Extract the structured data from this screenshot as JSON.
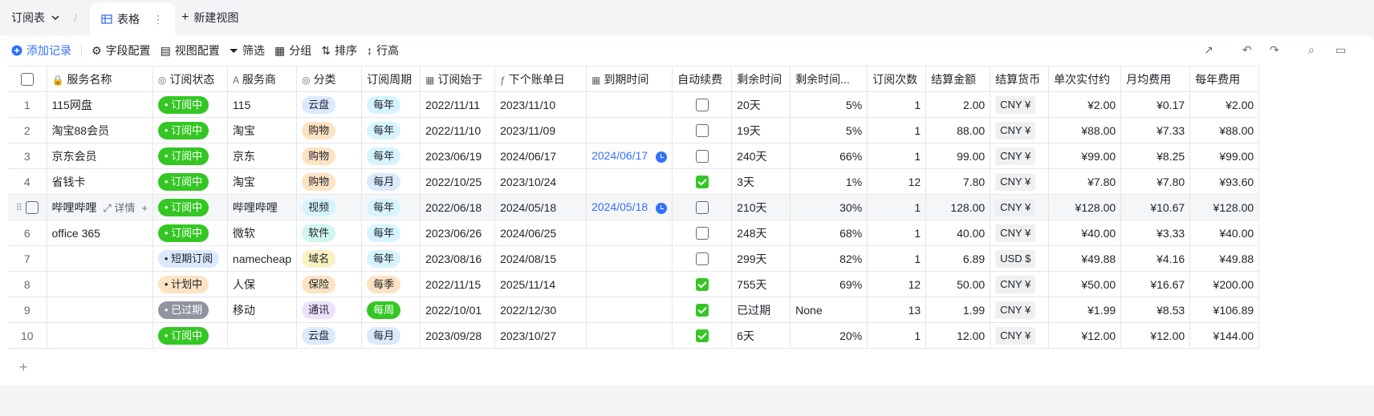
{
  "tabbar": {
    "table_name": "订阅表",
    "active_view": "表格",
    "new_view": "新建视图"
  },
  "toolbar": {
    "add_record": "添加记录",
    "field_config": "字段配置",
    "view_config": "视图配置",
    "filter": "筛选",
    "group": "分组",
    "sort": "排序",
    "row_height": "行高"
  },
  "columns": [
    "服务名称",
    "订阅状态",
    "服务商",
    "分类",
    "订阅周期",
    "订阅始于",
    "下个账单日",
    "到期时间",
    "自动续费",
    "剩余时间",
    "剩余时间...",
    "订阅次数",
    "结算金额",
    "结算货币",
    "单次实付约",
    "月均费用",
    "每年费用"
  ],
  "hover_row": {
    "detail_label": "详情"
  },
  "colors": {
    "accent": "#3370ff",
    "status_active": "#34c724",
    "status_expired": "#8f959e"
  },
  "rows": [
    {
      "idx": "1",
      "name": "115网盘",
      "status": "订阅中",
      "status_style": "active",
      "vendor": "115",
      "cat": "云盘",
      "cat_color": "#dbe9ff",
      "cycle": "每年",
      "cycle_color": "#d6f4ff",
      "start": "2022/11/11",
      "next": "2023/11/10",
      "expire": "",
      "auto": false,
      "remain": "20天",
      "remain_pct": "5%",
      "times": "1",
      "amount": "2.00",
      "currency": "CNY ¥",
      "once": "¥2.00",
      "monthly": "¥0.17",
      "yearly": "¥2.00"
    },
    {
      "idx": "2",
      "name": "淘宝88会员",
      "status": "订阅中",
      "status_style": "active",
      "vendor": "淘宝",
      "cat": "购物",
      "cat_color": "#fde3c4",
      "cycle": "每年",
      "cycle_color": "#d6f4ff",
      "start": "2022/11/10",
      "next": "2023/11/09",
      "expire": "",
      "auto": false,
      "remain": "19天",
      "remain_pct": "5%",
      "times": "1",
      "amount": "88.00",
      "currency": "CNY ¥",
      "once": "¥88.00",
      "monthly": "¥7.33",
      "yearly": "¥88.00"
    },
    {
      "idx": "3",
      "name": "京东会员",
      "status": "订阅中",
      "status_style": "active",
      "vendor": "京东",
      "cat": "购物",
      "cat_color": "#fde3c4",
      "cycle": "每年",
      "cycle_color": "#d6f4ff",
      "start": "2023/06/19",
      "next": "2024/06/17",
      "expire": "2024/06/17",
      "auto": false,
      "remain": "240天",
      "remain_pct": "66%",
      "times": "1",
      "amount": "99.00",
      "currency": "CNY ¥",
      "once": "¥99.00",
      "monthly": "¥8.25",
      "yearly": "¥99.00"
    },
    {
      "idx": "4",
      "name": "省钱卡",
      "status": "订阅中",
      "status_style": "active",
      "vendor": "淘宝",
      "cat": "购物",
      "cat_color": "#fde3c4",
      "cycle": "每月",
      "cycle_color": "#dbe9ff",
      "start": "2022/10/25",
      "next": "2023/10/24",
      "expire": "",
      "auto": true,
      "remain": "3天",
      "remain_pct": "1%",
      "times": "12",
      "amount": "7.80",
      "currency": "CNY ¥",
      "once": "¥7.80",
      "monthly": "¥7.80",
      "yearly": "¥93.60"
    },
    {
      "idx": "5",
      "name": "哔哩哔哩",
      "status": "订阅中",
      "status_style": "active",
      "vendor": "哔哩哔哩",
      "cat": "视频",
      "cat_color": "#d6f4ff",
      "cycle": "每年",
      "cycle_color": "#d6f4ff",
      "start": "2022/06/18",
      "next": "2024/05/18",
      "expire": "2024/05/18",
      "auto": false,
      "remain": "210天",
      "remain_pct": "30%",
      "times": "1",
      "amount": "128.00",
      "currency": "CNY ¥",
      "once": "¥128.00",
      "monthly": "¥10.67",
      "yearly": "¥128.00"
    },
    {
      "idx": "6",
      "name": "office 365",
      "status": "订阅中",
      "status_style": "active",
      "vendor": "微软",
      "cat": "软件",
      "cat_color": "#d1f5ef",
      "cycle": "每年",
      "cycle_color": "#d6f4ff",
      "start": "2023/06/26",
      "next": "2024/06/25",
      "expire": "",
      "auto": false,
      "remain": "248天",
      "remain_pct": "68%",
      "times": "1",
      "amount": "40.00",
      "currency": "CNY ¥",
      "once": "¥40.00",
      "monthly": "¥3.33",
      "yearly": "¥40.00"
    },
    {
      "idx": "7",
      "name": "",
      "status": "短期订阅",
      "status_style": "light-blue",
      "vendor": "namecheap",
      "cat": "域名",
      "cat_color": "#faf1c1",
      "cycle": "每年",
      "cycle_color": "#d6f4ff",
      "start": "2023/08/16",
      "next": "2024/08/15",
      "expire": "",
      "auto": false,
      "remain": "299天",
      "remain_pct": "82%",
      "times": "1",
      "amount": "6.89",
      "currency": "USD $",
      "once": "¥49.88",
      "monthly": "¥4.16",
      "yearly": "¥49.88"
    },
    {
      "idx": "8",
      "name": "",
      "status": "计划中",
      "status_style": "light-orange",
      "vendor": "人保",
      "cat": "保险",
      "cat_color": "#fde3c4",
      "cycle": "每季",
      "cycle_color": "#fde3c4",
      "start": "2022/11/15",
      "next": "2025/11/14",
      "expire": "",
      "auto": true,
      "remain": "755天",
      "remain_pct": "69%",
      "times": "12",
      "amount": "50.00",
      "currency": "CNY ¥",
      "once": "¥50.00",
      "monthly": "¥16.67",
      "yearly": "¥200.00"
    },
    {
      "idx": "9",
      "name": "",
      "status": "已过期",
      "status_style": "expired",
      "vendor": "移动",
      "cat": "通讯",
      "cat_color": "#ece2fe",
      "cycle": "每周",
      "cycle_color": "#34c724",
      "start": "2022/10/01",
      "next": "2022/12/30",
      "expire": "",
      "auto": true,
      "remain": "已过期",
      "remain_pct": "None",
      "times": "13",
      "amount": "1.99",
      "currency": "CNY ¥",
      "once": "¥1.99",
      "monthly": "¥8.53",
      "yearly": "¥106.89"
    },
    {
      "idx": "10",
      "name": "",
      "status": "订阅中",
      "status_style": "active",
      "vendor": "",
      "cat": "云盘",
      "cat_color": "#dbe9ff",
      "cycle": "每月",
      "cycle_color": "#dbe9ff",
      "start": "2023/09/28",
      "next": "2023/10/27",
      "expire": "",
      "auto": true,
      "remain": "6天",
      "remain_pct": "20%",
      "times": "1",
      "amount": "12.00",
      "currency": "CNY ¥",
      "once": "¥12.00",
      "monthly": "¥12.00",
      "yearly": "¥144.00"
    }
  ]
}
